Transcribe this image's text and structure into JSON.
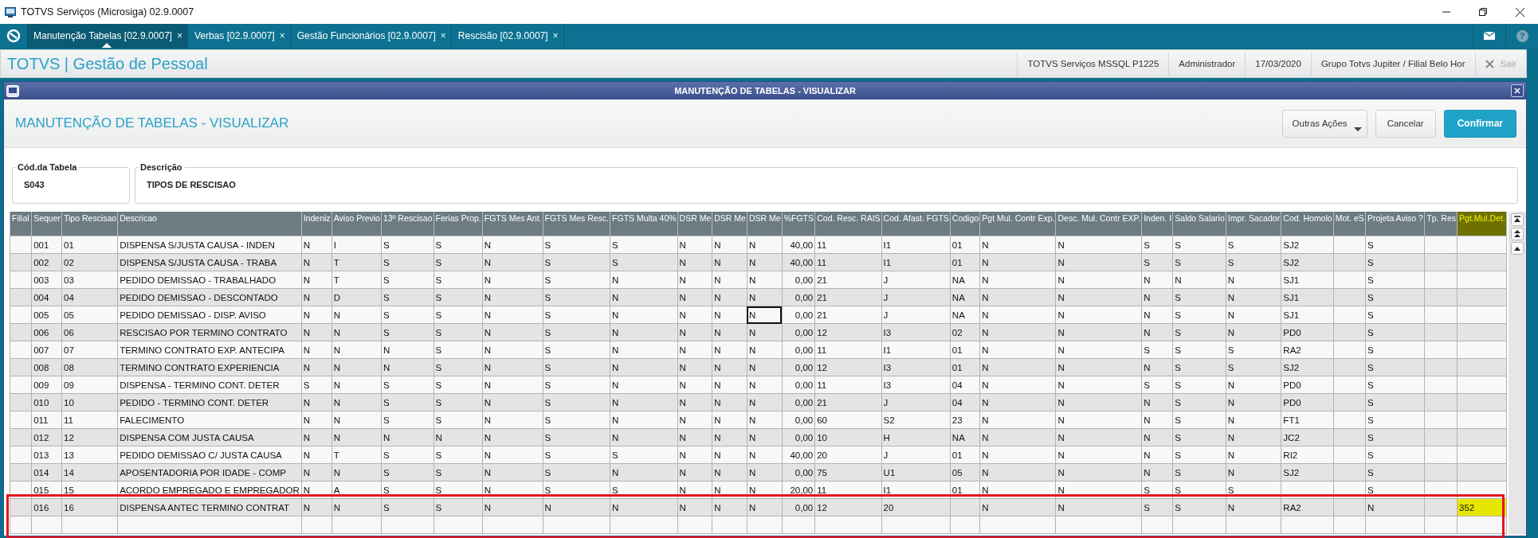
{
  "window": {
    "title": "TOTVS Serviços (Microsiga) 02.9.0007"
  },
  "tabs": [
    {
      "label": "Manutenção Tabelas [02.9.0007]",
      "close": "×",
      "selected": true
    },
    {
      "label": "Verbas [02.9.0007]",
      "close": "×",
      "selected": false
    },
    {
      "label": "Gestão Funcionários [02.9.0007]",
      "close": "×",
      "selected": false
    },
    {
      "label": "Rescisão [02.9.0007]",
      "close": "×",
      "selected": false
    }
  ],
  "help": "?",
  "app_header": {
    "title": "TOTVS | Gestão de Pessoal",
    "info": [
      "TOTVS Serviços MSSQL P1225",
      "Administrador",
      "17/03/2020",
      "Grupo Totvs Jupiter / Filial Belo Hor"
    ],
    "exit": {
      "label": "Sair",
      "disabled": true
    }
  },
  "dialog": {
    "title": "MANUTENÇÃO DE TABELAS - VISUALIZAR",
    "heading": "MANUTENÇÃO DE TABELAS - VISUALIZAR",
    "buttons": [
      {
        "label": "Outras Ações",
        "kind": "menu"
      },
      {
        "label": "Cancelar",
        "kind": "default"
      },
      {
        "label": "Confirmar",
        "kind": "primary"
      }
    ],
    "fields": [
      {
        "label": "Cód.da Tabela",
        "value": "S043"
      },
      {
        "label": "Descrição",
        "value": "TIPOS DE RESCISAO"
      }
    ],
    "table": {
      "columns": [
        {
          "label": "Filial",
          "kind": "text",
          "current": false,
          "highlighted": false
        },
        {
          "label": "Sequer",
          "kind": "text",
          "current": false,
          "highlighted": false
        },
        {
          "label": "Tipo Rescisao",
          "kind": "text",
          "current": false,
          "highlighted": false
        },
        {
          "label": "Descricao",
          "kind": "text",
          "current": false,
          "highlighted": false
        },
        {
          "label": "Indeniz",
          "kind": "text",
          "current": false,
          "highlighted": false
        },
        {
          "label": "Aviso Previo",
          "kind": "text",
          "current": false,
          "highlighted": false
        },
        {
          "label": "13º Rescisao",
          "kind": "text",
          "current": false,
          "highlighted": false
        },
        {
          "label": "Ferias Prop.",
          "kind": "text",
          "current": false,
          "highlighted": false
        },
        {
          "label": "FGTS Mes Ant.",
          "kind": "text",
          "current": false,
          "highlighted": false
        },
        {
          "label": "FGTS Mes Resc.",
          "kind": "text",
          "current": false,
          "highlighted": false
        },
        {
          "label": "FGTS Multa 40%",
          "kind": "text",
          "current": false,
          "highlighted": false
        },
        {
          "label": "DSR Me",
          "kind": "text",
          "current": false,
          "highlighted": false
        },
        {
          "label": "DSR Me",
          "kind": "text",
          "current": false,
          "highlighted": false
        },
        {
          "label": "DSR Me",
          "kind": "text",
          "current": false,
          "highlighted": false
        },
        {
          "label": "%FGTS",
          "kind": "number",
          "current": false,
          "highlighted": false
        },
        {
          "label": "Cod. Resc. RAIS",
          "kind": "text",
          "current": false,
          "highlighted": false
        },
        {
          "label": "Cod. Afast. FGTS",
          "kind": "text",
          "current": false,
          "highlighted": false
        },
        {
          "label": "Codigo",
          "kind": "text",
          "current": false,
          "highlighted": false
        },
        {
          "label": "Pgt Mul. Contr Exp.",
          "kind": "text",
          "current": false,
          "highlighted": false
        },
        {
          "label": "Desc. Mul. Contr EXP.",
          "kind": "text",
          "current": false,
          "highlighted": false
        },
        {
          "label": "Inden. I",
          "kind": "text",
          "current": false,
          "highlighted": false
        },
        {
          "label": "Saldo Salario",
          "kind": "text",
          "current": false,
          "highlighted": false
        },
        {
          "label": "Impr. Sacador",
          "kind": "text",
          "current": false,
          "highlighted": false
        },
        {
          "label": "Cod. Homolo",
          "kind": "text",
          "current": false,
          "highlighted": false
        },
        {
          "label": "Mot. eS",
          "kind": "text",
          "current": false,
          "highlighted": false
        },
        {
          "label": "Projeta Aviso ?",
          "kind": "text",
          "current": false,
          "highlighted": false
        },
        {
          "label": "Tp. Res",
          "kind": "text",
          "current": false,
          "highlighted": false
        },
        {
          "label": "Pgt.Mul.Det.",
          "kind": "text",
          "current": false,
          "highlighted": true
        }
      ],
      "rows": [
        {
          "selected": false,
          "annotated": false,
          "cells": [
            null,
            "001",
            "01",
            "DISPENSA S/JUSTA CAUSA - INDEN",
            "N",
            "I",
            "S",
            "S",
            "N",
            "S",
            "S",
            "N",
            "N",
            "N",
            "40,00",
            "11",
            "I1",
            "01",
            "N",
            "N",
            "S",
            "S",
            "S",
            "SJ2",
            null,
            "S",
            null,
            null
          ]
        },
        {
          "selected": false,
          "annotated": false,
          "cells": [
            null,
            "002",
            "02",
            "DISPENSA S/JUSTA CAUSA - TRABA",
            "N",
            "T",
            "S",
            "S",
            "N",
            "S",
            "S",
            "N",
            "N",
            "N",
            "40,00",
            "11",
            "I1",
            "01",
            "N",
            "N",
            "S",
            "S",
            "S",
            "SJ2",
            null,
            "S",
            null,
            null
          ]
        },
        {
          "selected": false,
          "annotated": false,
          "cells": [
            null,
            "003",
            "03",
            "PEDIDO DEMISSAO - TRABALHADO",
            "N",
            "T",
            "S",
            "S",
            "N",
            "S",
            "N",
            "N",
            "N",
            "N",
            "0,00",
            "21",
            "J",
            "NA",
            "N",
            "N",
            "N",
            "N",
            "N",
            "SJ1",
            null,
            "S",
            null,
            null
          ]
        },
        {
          "selected": false,
          "annotated": false,
          "cells": [
            null,
            "004",
            "04",
            "PEDIDO DEMISSAO - DESCONTADO",
            "N",
            "D",
            "S",
            "S",
            "N",
            "S",
            "N",
            "N",
            "N",
            "N",
            "0,00",
            "21",
            "J",
            "NA",
            "N",
            "N",
            "N",
            "S",
            "N",
            "SJ1",
            null,
            "S",
            null,
            null
          ]
        },
        {
          "selected": false,
          "annotated": false,
          "cells": [
            null,
            "005",
            "05",
            "PEDIDO DEMISSAO - DISP. AVISO",
            "N",
            "N",
            "S",
            "S",
            "N",
            "S",
            "N",
            "N",
            "N",
            {
              "text": "N",
              "focused": true
            },
            "0,00",
            "21",
            "J",
            "NA",
            "N",
            "N",
            "N",
            "S",
            "N",
            "SJ1",
            null,
            "S",
            null,
            null
          ]
        },
        {
          "selected": false,
          "annotated": false,
          "cells": [
            null,
            "006",
            "06",
            "RESCISAO POR TERMINO CONTRATO",
            "N",
            "N",
            "S",
            "S",
            "N",
            "S",
            "N",
            "N",
            "N",
            "N",
            "0,00",
            "12",
            "I3",
            "02",
            "N",
            "N",
            "N",
            "S",
            "N",
            "PD0",
            null,
            "S",
            null,
            null
          ]
        },
        {
          "selected": false,
          "annotated": false,
          "cells": [
            null,
            "007",
            "07",
            "TERMINO CONTRATO EXP. ANTECIPA",
            "N",
            "N",
            "N",
            "S",
            "N",
            "S",
            "N",
            "N",
            "N",
            "N",
            "0,00",
            "11",
            "I1",
            "01",
            "N",
            "N",
            "S",
            "S",
            "S",
            "RA2",
            null,
            "S",
            null,
            null
          ]
        },
        {
          "selected": false,
          "annotated": false,
          "cells": [
            null,
            "008",
            "08",
            "TERMINO CONTRATO EXPERIENCIA",
            "N",
            "N",
            "N",
            "S",
            "N",
            "S",
            "N",
            "N",
            "N",
            "N",
            "0,00",
            "12",
            "I3",
            "01",
            "N",
            "N",
            "N",
            "S",
            "S",
            "SJ2",
            null,
            "S",
            null,
            null
          ]
        },
        {
          "selected": false,
          "annotated": false,
          "cells": [
            null,
            "009",
            "09",
            "DISPENSA - TERMINO CONT. DETER",
            "S",
            "N",
            "S",
            "S",
            "N",
            "S",
            "N",
            "N",
            "N",
            "N",
            "0,00",
            "11",
            "I3",
            "04",
            "N",
            "N",
            "S",
            "S",
            "N",
            "PD0",
            null,
            "S",
            null,
            null
          ]
        },
        {
          "selected": false,
          "annotated": false,
          "cells": [
            null,
            "010",
            "10",
            "PEDIDO - TERMINO CONT. DETER",
            "N",
            "N",
            "S",
            "S",
            "N",
            "S",
            "N",
            "N",
            "N",
            "N",
            "0,00",
            "21",
            "J",
            "04",
            "N",
            "N",
            "N",
            "S",
            "N",
            "PD0",
            null,
            "S",
            null,
            null
          ]
        },
        {
          "selected": false,
          "annotated": false,
          "cells": [
            null,
            "011",
            "11",
            "FALECIMENTO",
            "N",
            "N",
            "S",
            "S",
            "N",
            "S",
            "N",
            "N",
            "N",
            "N",
            "0,00",
            "60",
            "S2",
            "23",
            "N",
            "N",
            "N",
            "S",
            "N",
            "FT1",
            null,
            "S",
            null,
            null
          ]
        },
        {
          "selected": false,
          "annotated": false,
          "cells": [
            null,
            "012",
            "12",
            "DISPENSA COM JUSTA CAUSA",
            "N",
            "N",
            "N",
            "N",
            "N",
            "S",
            "N",
            "N",
            "N",
            "N",
            "0,00",
            "10",
            "H",
            "NA",
            "N",
            "N",
            "N",
            "S",
            "N",
            "JC2",
            null,
            "S",
            null,
            null
          ]
        },
        {
          "selected": false,
          "annotated": false,
          "cells": [
            null,
            "013",
            "13",
            "PEDIDO DEMISSAO C/ JUSTA CAUSA",
            "N",
            "T",
            "S",
            "S",
            "N",
            "S",
            "S",
            "N",
            "N",
            "N",
            "40,00",
            "20",
            "J",
            "01",
            "N",
            "N",
            "N",
            "S",
            "N",
            "RI2",
            null,
            "S",
            null,
            null
          ]
        },
        {
          "selected": false,
          "annotated": false,
          "cells": [
            null,
            "014",
            "14",
            "APOSENTADORIA POR IDADE - COMP",
            "N",
            "N",
            "S",
            "S",
            "N",
            "S",
            "N",
            "N",
            "N",
            "N",
            "0,00",
            "75",
            "U1",
            "05",
            "N",
            "N",
            "N",
            "S",
            "N",
            "SJ2",
            null,
            "S",
            null,
            null
          ]
        },
        {
          "selected": false,
          "annotated": false,
          "cells": [
            null,
            "015",
            "15",
            "ACORDO EMPREGADO E EMPREGADOR",
            "N",
            "A",
            "S",
            "S",
            "N",
            "S",
            "S",
            "N",
            "N",
            "N",
            "20,00",
            "11",
            "I1",
            "01",
            "N",
            "N",
            "S",
            "S",
            "S",
            null,
            null,
            "S",
            null,
            null
          ]
        },
        {
          "selected": false,
          "annotated": true,
          "cells": [
            null,
            "016",
            "16",
            "DISPENSA ANTEC TERMINO CONTRAT",
            "N",
            "N",
            "S",
            "S",
            "N",
            "N",
            "N",
            "N",
            "N",
            "N",
            "0,00",
            "12",
            "20",
            null,
            "N",
            "N",
            "S",
            "S",
            "N",
            "RA2",
            null,
            "N",
            null,
            "352"
          ]
        }
      ]
    }
  }
}
